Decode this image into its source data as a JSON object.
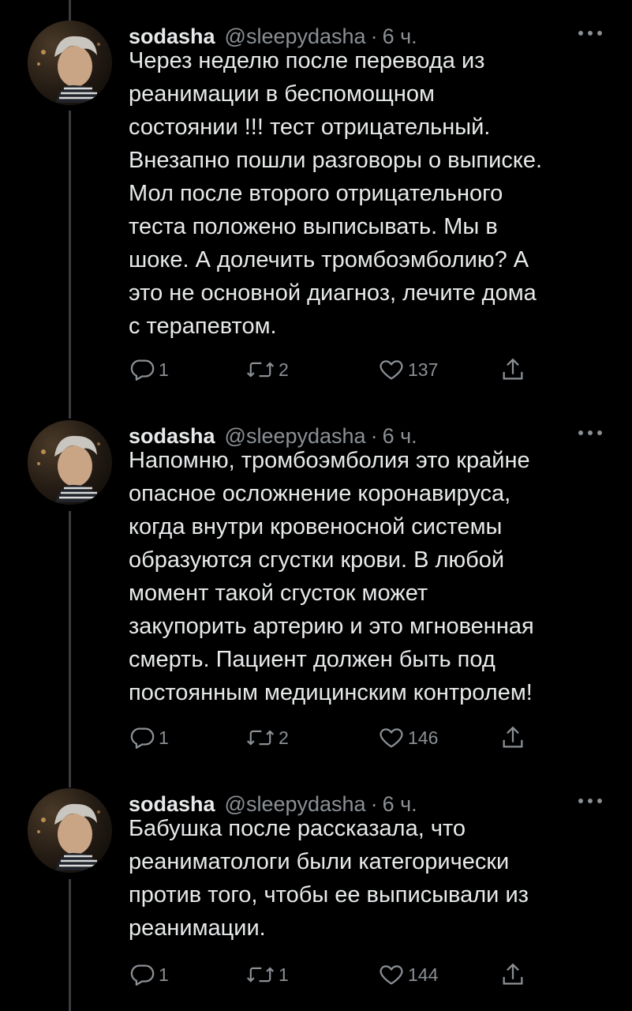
{
  "tweets": [
    {
      "name": "sodasha",
      "handle": "@sleepydasha",
      "separator": "·",
      "time": "6 ч.",
      "lines": [
        "Через неделю после перевода из",
        "реанимации в беспомощном",
        "состоянии !!! тест отрицательный.",
        "Внезапно пошли разговоры о выписке.",
        "Мол после второго отрицательного",
        "теста положено выписывать. Мы в",
        "шоке. А долечить тромбоэмболию? А",
        "это не основной диагноз, лечите дома",
        "с терапевтом."
      ],
      "replies": "1",
      "retweets": "2",
      "likes": "137"
    },
    {
      "name": "sodasha",
      "handle": "@sleepydasha",
      "separator": "·",
      "time": "6 ч.",
      "lines": [
        "Напомню, тромбоэмболия это крайне",
        "опасное осложнение коронавируса,",
        "когда внутри кровеносной системы",
        "образуются сгустки крови. В любой",
        "момент такой сгусток может",
        "закупорить артерию и это мгновенная",
        "смерть. Пациент должен быть под",
        "постоянным медицинским контролем!"
      ],
      "replies": "1",
      "retweets": "2",
      "likes": "146"
    },
    {
      "name": "sodasha",
      "handle": "@sleepydasha",
      "separator": "·",
      "time": "6 ч.",
      "lines": [
        "Бабушка после рассказала, что",
        "реаниматологи были категорически",
        "против того, чтобы ее выписывали из",
        "реанимации."
      ],
      "replies": "1",
      "retweets": "1",
      "likes": "144"
    }
  ],
  "icons": {
    "more": "more-horizontal-icon",
    "reply": "reply-bubble-icon",
    "retweet": "retweet-arrows-icon",
    "like": "heart-outline-icon",
    "share": "share-upload-icon"
  },
  "colors": {
    "background": "#000000",
    "text": "#e7e9ea",
    "secondary": "#8b9095",
    "thread_line": "#3a3d40"
  }
}
